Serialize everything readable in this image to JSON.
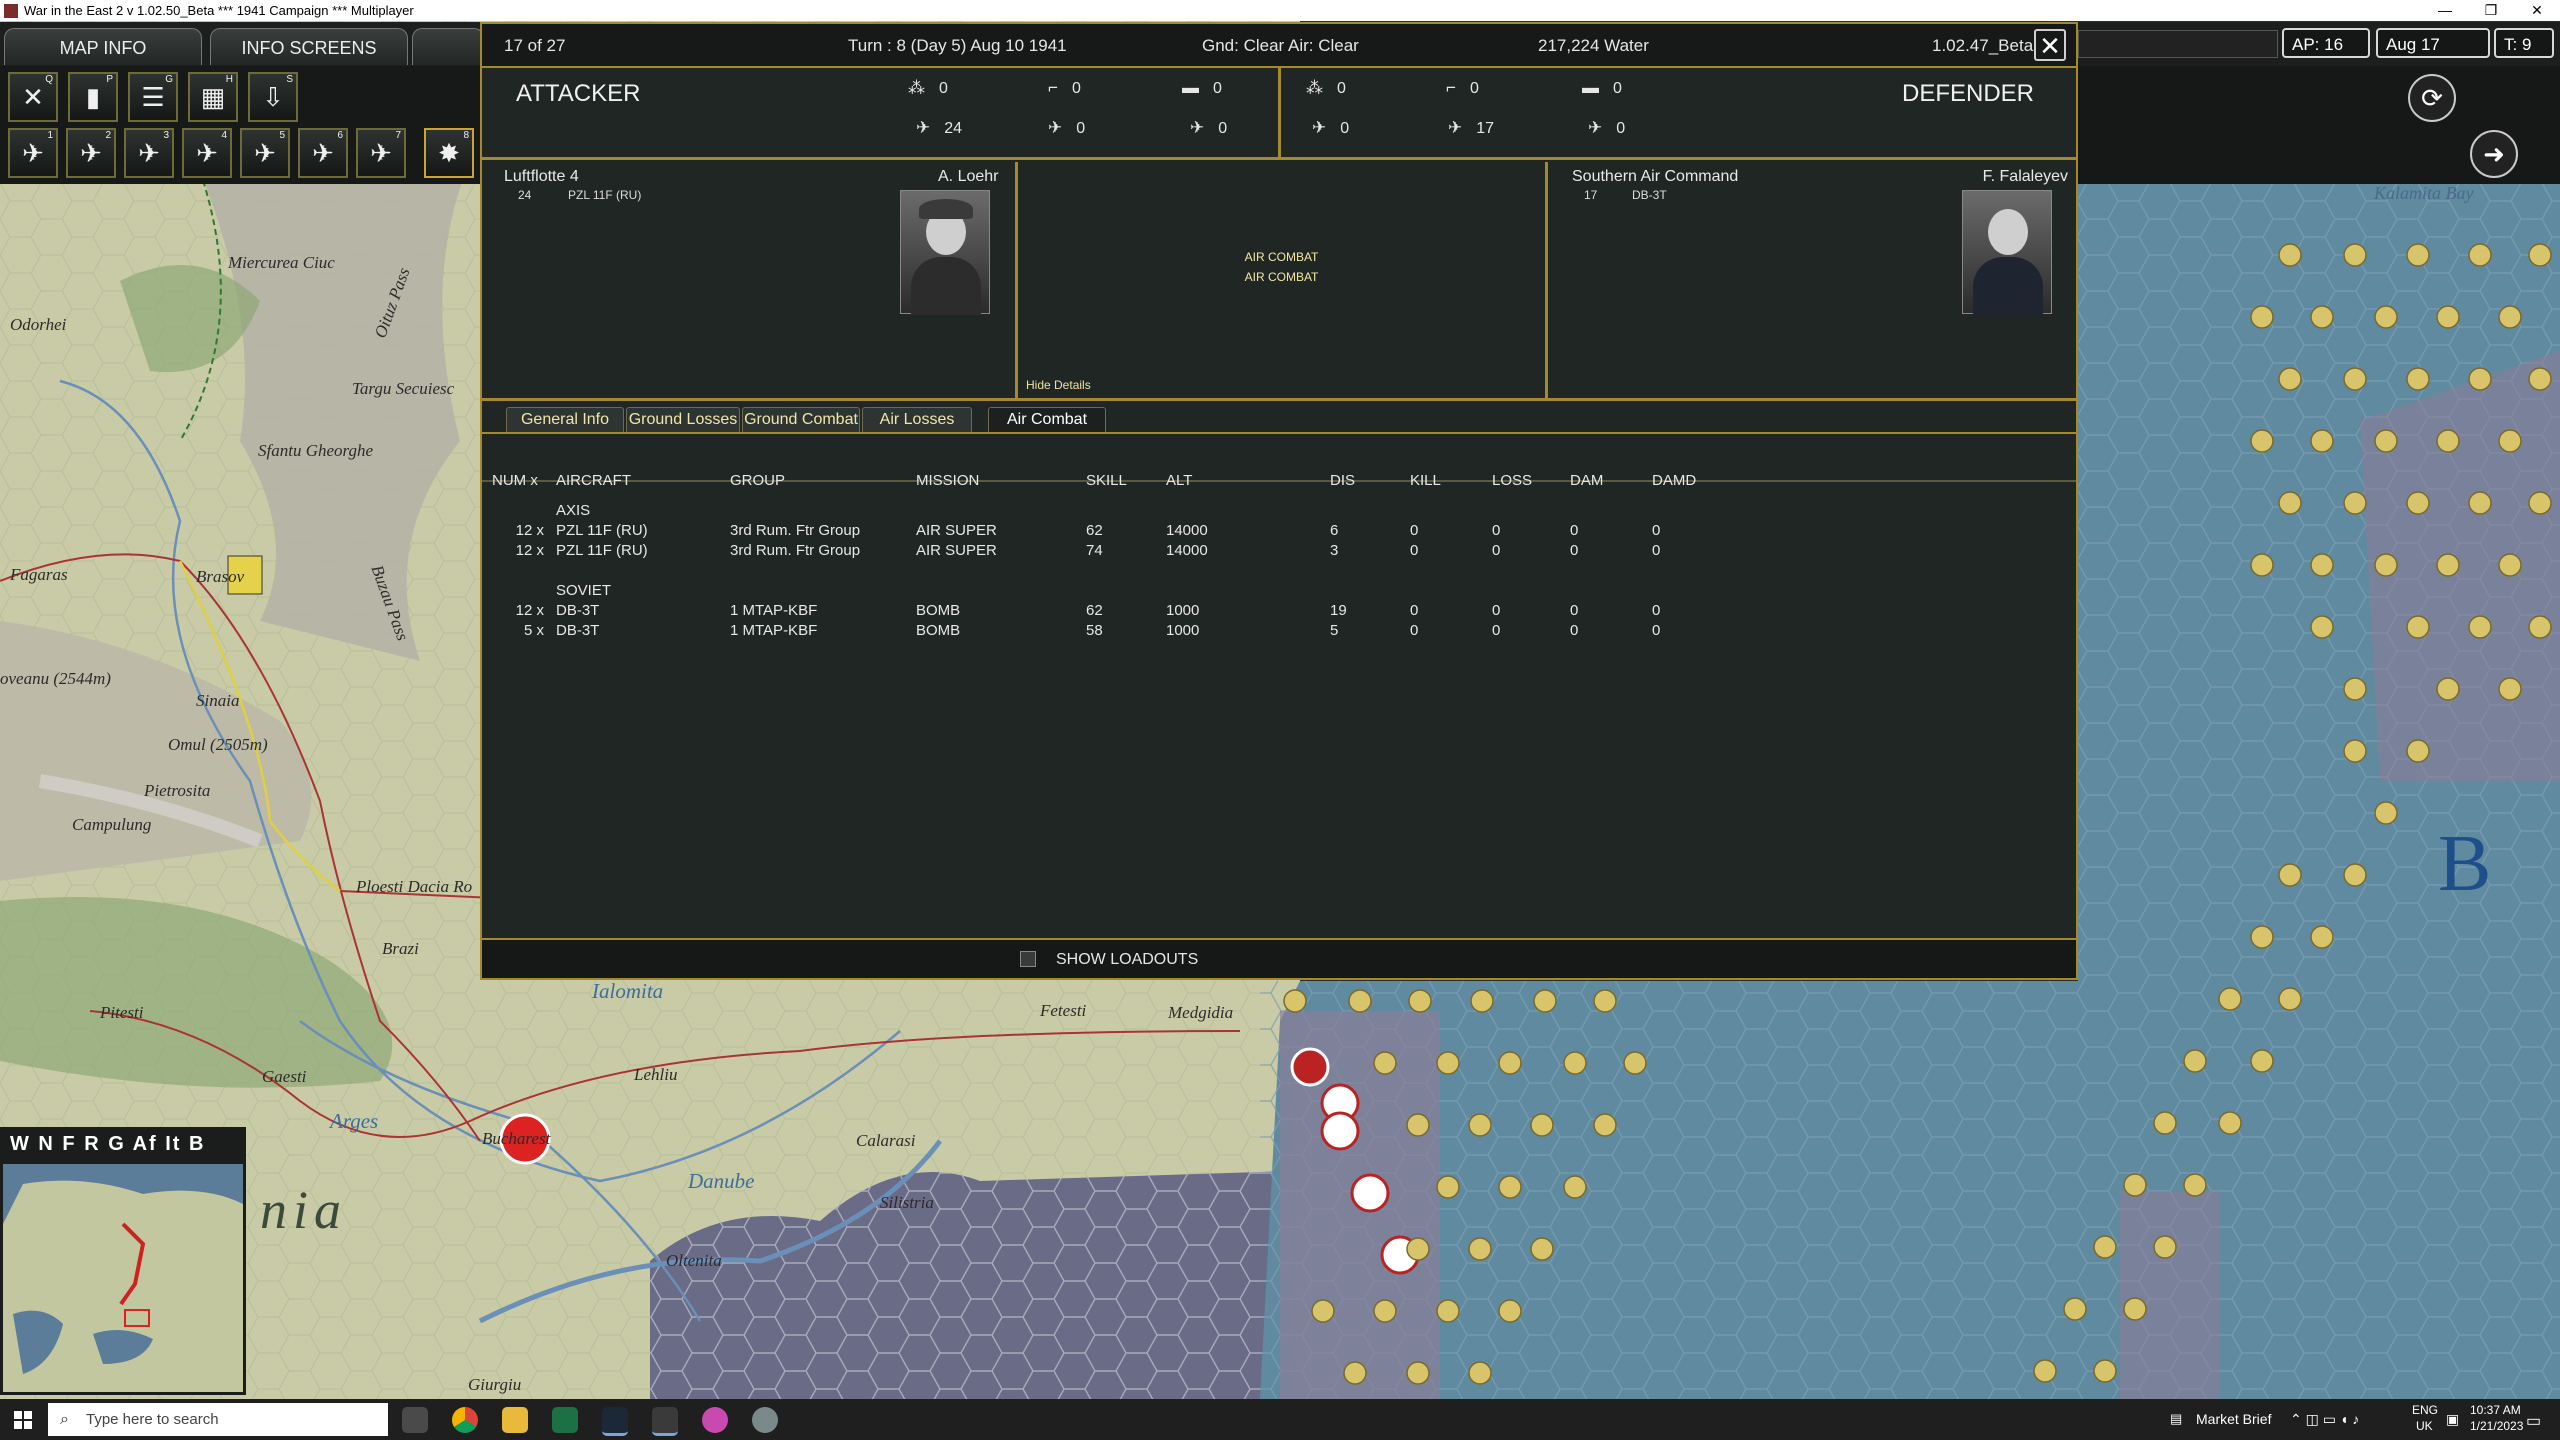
{
  "window": {
    "title": "War in the East 2  v 1.02.50_Beta   ***  1941 Campaign  ***  Multiplayer",
    "minimize": "—",
    "restore": "❐",
    "close": "✕"
  },
  "game_tabs": {
    "map_info": "MAP INFO",
    "info_screens": "INFO SCREENS"
  },
  "top_right": {
    "ap": "AP: 16",
    "date": "Aug 17 1941",
    "turn": "T: 9"
  },
  "toolbar_icons": {
    "row1": [
      {
        "name": "close-map-icon",
        "glyph": "✕",
        "key": "Q"
      },
      {
        "name": "unit-list-icon",
        "glyph": "▮",
        "key": "P"
      },
      {
        "name": "list-icon",
        "glyph": "☰",
        "key": "G"
      },
      {
        "name": "oob-icon",
        "glyph": "▦",
        "key": "H"
      },
      {
        "name": "save-icon",
        "glyph": "⇩",
        "key": "S"
      }
    ],
    "row2": [
      {
        "name": "air-mission-cancel-icon",
        "glyph": "✈",
        "key": "1"
      },
      {
        "name": "air-transport-icon",
        "glyph": "✈",
        "key": "2"
      },
      {
        "name": "air-ground-attack-icon",
        "glyph": "✈",
        "key": "3"
      },
      {
        "name": "air-strike-icon",
        "glyph": "✈",
        "key": "4"
      },
      {
        "name": "air-recon-icon",
        "glyph": "✈",
        "key": "5"
      },
      {
        "name": "air-superiority-icon",
        "glyph": "✈",
        "key": "6"
      },
      {
        "name": "air-supply-icon",
        "glyph": "✈",
        "key": "7"
      },
      {
        "name": "air-bomb-icon",
        "glyph": "✸",
        "key": "8"
      }
    ]
  },
  "dialog": {
    "counter": "17 of 27",
    "turn": "Turn : 8 (Day 5)   Aug 10 1941",
    "weather": "Gnd: Clear  Air: Clear",
    "location": "217,224   Water",
    "version": "1.02.47_Beta",
    "close": "✕",
    "attacker": {
      "title": "ATTACKER",
      "counts_top": [
        "0",
        "0",
        "0"
      ],
      "counts_bottom": [
        "24",
        "0",
        "0"
      ],
      "commander_group": "Luftflotte 4",
      "leader": "A. Loehr",
      "unit_count": "24",
      "unit_type": "PZL 11F (RU)"
    },
    "defender": {
      "title": "DEFENDER",
      "counts_top": [
        "0",
        "0",
        "0"
      ],
      "counts_bottom": [
        "0",
        "17",
        "0"
      ],
      "commander_group": "Southern Air Command",
      "leader": "F. Falaleyev",
      "unit_count": "17",
      "unit_type": "DB-3T"
    },
    "middle": {
      "line1": "AIR COMBAT",
      "line2": "AIR COMBAT",
      "hide_details": "Hide Details"
    },
    "tabs": [
      "General Info",
      "Ground Losses",
      "Ground Combat",
      "Air Losses",
      "Air Combat"
    ],
    "active_tab": 4,
    "table": {
      "headers": [
        "NUM x",
        "AIRCRAFT",
        "GROUP",
        "MISSION",
        "SKILL",
        "ALT",
        "DIS",
        "KILL",
        "LOSS",
        "DAM",
        "DAMD"
      ],
      "sections": [
        {
          "name": "AXIS",
          "rows": [
            [
              "12 x",
              "PZL 11F (RU)",
              "3rd Rum. Ftr Group",
              "AIR SUPER",
              "62",
              "14000",
              "6",
              "0",
              "0",
              "0",
              "0"
            ],
            [
              "12 x",
              "PZL 11F (RU)",
              "3rd Rum. Ftr Group",
              "AIR SUPER",
              "74",
              "14000",
              "3",
              "0",
              "0",
              "0",
              "0"
            ]
          ]
        },
        {
          "name": "SOVIET",
          "rows": [
            [
              "12 x",
              "DB-3T",
              "1 MTAP-KBF",
              "BOMB",
              "62",
              "1000",
              "19",
              "0",
              "0",
              "0",
              "0"
            ],
            [
              "5 x",
              "DB-3T",
              "1 MTAP-KBF",
              "BOMB",
              "58",
              "1000",
              "5",
              "0",
              "0",
              "0",
              "0"
            ]
          ]
        }
      ]
    },
    "show_loadouts": "SHOW LOADOUTS"
  },
  "map_labels": [
    {
      "t": "Miercurea Ciuc",
      "k": ""
    },
    {
      "t": "Odorhei",
      "k": ""
    },
    {
      "t": "Targu Secuiesc",
      "k": ""
    },
    {
      "t": "Sfantu Gheorghe",
      "k": ""
    },
    {
      "t": "Fagaras",
      "k": ""
    },
    {
      "t": "Brasov",
      "k": ""
    },
    {
      "t": "oveanu (2544m)",
      "k": ""
    },
    {
      "t": "Sinaia",
      "k": ""
    },
    {
      "t": "Omul (2505m)",
      "k": ""
    },
    {
      "t": "Pietrosita",
      "k": ""
    },
    {
      "t": "Campulung",
      "k": ""
    },
    {
      "t": "Ploesti Dacia Ro",
      "k": ""
    },
    {
      "t": "Brazi",
      "k": ""
    },
    {
      "t": "Pitesti",
      "k": ""
    },
    {
      "t": "Ialomita",
      "k": "water"
    },
    {
      "t": "Fetesti",
      "k": ""
    },
    {
      "t": "Medgidia",
      "k": ""
    },
    {
      "t": "Lehliu",
      "k": ""
    },
    {
      "t": "Gaesti",
      "k": ""
    },
    {
      "t": "Arges",
      "k": "water"
    },
    {
      "t": "Bucharest",
      "k": ""
    },
    {
      "t": "Calarasi",
      "k": ""
    },
    {
      "t": "Danube",
      "k": "water"
    },
    {
      "t": "Silistria",
      "k": ""
    },
    {
      "t": "Oltenita",
      "k": ""
    },
    {
      "t": "Giurgiu",
      "k": ""
    },
    {
      "t": "nia",
      "k": "big"
    },
    {
      "t": "Kalamita Bay",
      "k": "bay"
    },
    {
      "t": "B",
      "k": "sea"
    },
    {
      "t": "Oituz Pass",
      "k": ""
    },
    {
      "t": "Buzau Pass",
      "k": ""
    }
  ],
  "minimap_bar": "W N F R G Af It B",
  "taskbar": {
    "search": "Type here to search",
    "market": "Market Brief",
    "lang1": "ENG",
    "lang2": "UK",
    "time": "10:37 AM",
    "date": "1/21/2023"
  }
}
